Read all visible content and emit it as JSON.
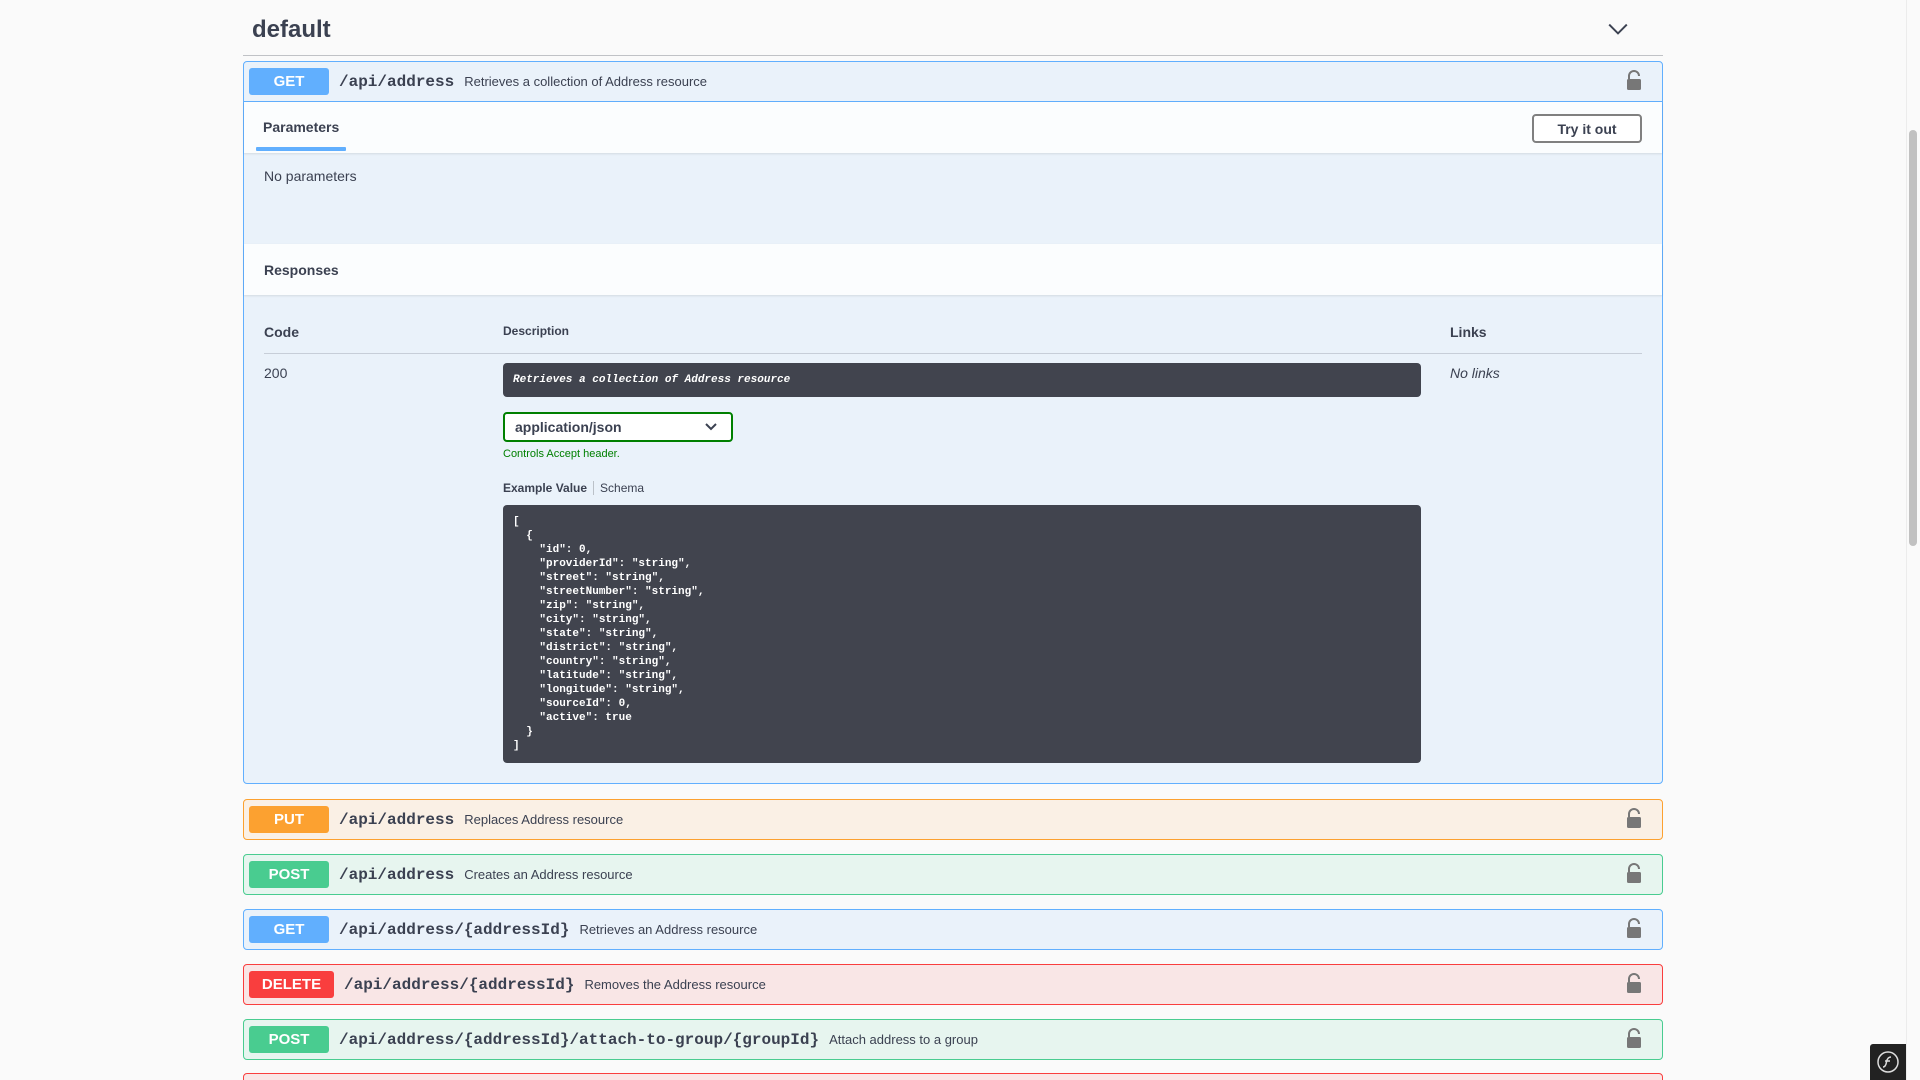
{
  "tag": {
    "title": "default"
  },
  "expanded_op": {
    "method": "GET",
    "path": "/api/address",
    "summary": "Retrieves a collection of Address resource",
    "tabs": {
      "parameters": "Parameters"
    },
    "try_it_out": "Try it out",
    "no_parameters": "No parameters",
    "responses_title": "Responses",
    "columns": {
      "code": "Code",
      "description": "Description",
      "links": "Links"
    },
    "response": {
      "code": "200",
      "description": "Retrieves a collection of Address resource",
      "links": "No links",
      "media_type": "application/json",
      "controls_note": "Controls Accept header.",
      "example_tab": "Example Value",
      "schema_tab": "Schema",
      "example": "[\n  {\n    \"id\": 0,\n    \"providerId\": \"string\",\n    \"street\": \"string\",\n    \"streetNumber\": \"string\",\n    \"zip\": \"string\",\n    \"city\": \"string\",\n    \"state\": \"string\",\n    \"district\": \"string\",\n    \"country\": \"string\",\n    \"latitude\": \"string\",\n    \"longitude\": \"string\",\n    \"sourceId\": 0,\n    \"active\": true\n  }\n]"
    }
  },
  "operations": [
    {
      "method": "PUT",
      "path": "/api/address",
      "summary": "Replaces Address resource"
    },
    {
      "method": "POST",
      "path": "/api/address",
      "summary": "Creates an Address resource"
    },
    {
      "method": "GET",
      "path": "/api/address/{addressId}",
      "summary": "Retrieves an Address resource"
    },
    {
      "method": "DELETE",
      "path": "/api/address/{addressId}",
      "summary": "Removes the Address resource"
    },
    {
      "method": "POST",
      "path": "/api/address/{addressId}/attach-to-group/{groupId}",
      "summary": "Attach address to a group"
    }
  ],
  "colors": {
    "get": "#61affe",
    "put": "#fca130",
    "post": "#49cc90",
    "delete": "#f93e3e"
  }
}
